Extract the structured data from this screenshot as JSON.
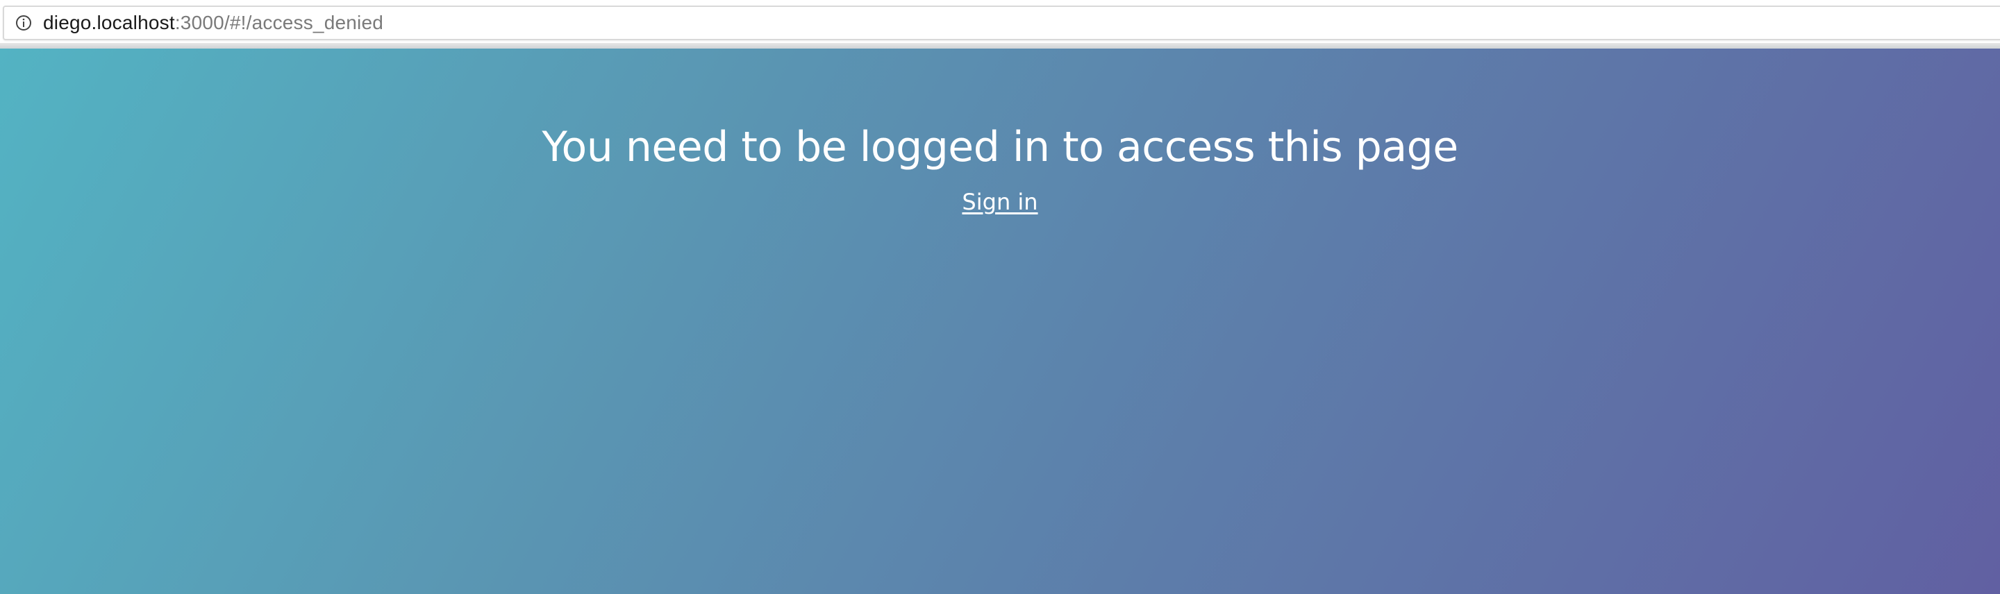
{
  "browser": {
    "site_info_icon": "info-circle-icon",
    "url_host": "diego.localhost",
    "url_path": ":3000/#!/access_denied"
  },
  "page": {
    "headline": "You need to be logged in to access this page",
    "sign_in_label": "Sign in",
    "colors": {
      "gradient_start": "#53b3c3",
      "gradient_end": "#6160a2",
      "text": "#ffffff"
    }
  }
}
